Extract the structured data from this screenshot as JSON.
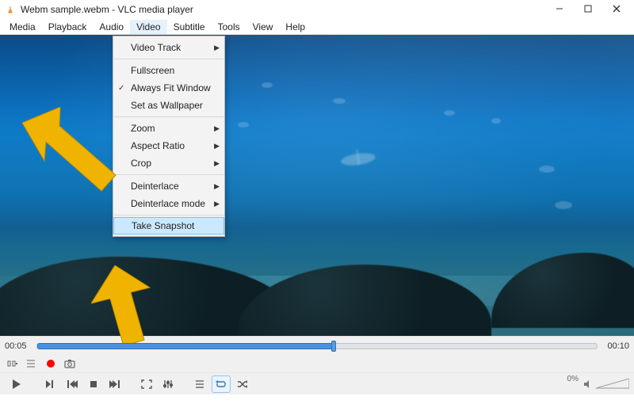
{
  "titlebar": {
    "title": "Webm sample.webm - VLC media player"
  },
  "menubar": {
    "items": [
      "Media",
      "Playback",
      "Audio",
      "Video",
      "Subtitle",
      "Tools",
      "View",
      "Help"
    ],
    "open_index": 3
  },
  "dropdown": {
    "items": [
      {
        "label": "Video Track",
        "submenu": true
      },
      {
        "label": "Fullscreen"
      },
      {
        "label": "Always Fit Window",
        "checked": true
      },
      {
        "label": "Set as Wallpaper"
      },
      {
        "label": "Zoom",
        "submenu": true
      },
      {
        "label": "Aspect Ratio",
        "submenu": true
      },
      {
        "label": "Crop",
        "submenu": true
      },
      {
        "label": "Deinterlace",
        "submenu": true
      },
      {
        "label": "Deinterlace mode",
        "submenu": true
      },
      {
        "label": "Take Snapshot",
        "highlight": true
      }
    ]
  },
  "seek": {
    "current": "00:05",
    "total": "00:10",
    "progress_pct": 53
  },
  "volume": {
    "percent_label": "0%"
  }
}
